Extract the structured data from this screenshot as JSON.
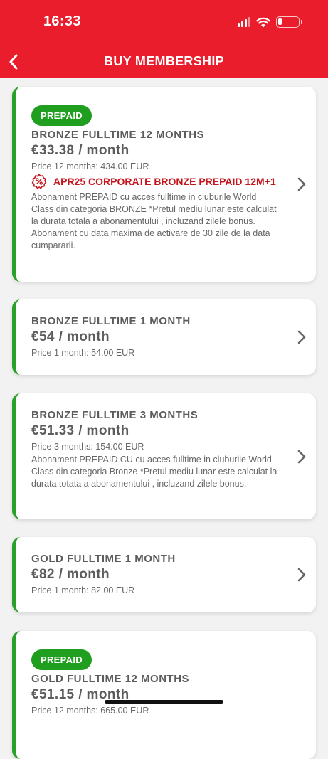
{
  "status_bar": {
    "time": "16:33"
  },
  "header": {
    "title": "BUY MEMBERSHIP",
    "back_icon": "chevron-left-icon"
  },
  "colors": {
    "header_bg": "#ea1d2c",
    "accent_green": "#2aa02a",
    "promo_red": "#c4141c"
  },
  "cards": [
    {
      "badge": "PREPAID",
      "title": "BRONZE FULLTIME 12 MONTHS",
      "price": "€33.38 / month",
      "subtitle": "Price 12 months: 434.00 EUR",
      "promo": "APR25 CORPORATE BRONZE PREPAID 12M+1",
      "description": "Abonament PREPAID cu acces fulltime in cluburile World Class din categoria BRONZE  *Pretul mediu lunar este calculat la durata totala a abonamentului , incluzand zilele bonus. Abonament cu data maxima de activare de 30 zile de la data cumpararii."
    },
    {
      "title": "BRONZE FULLTIME 1 MONTH",
      "price": "€54 / month",
      "subtitle": "Price 1 month: 54.00 EUR"
    },
    {
      "title": "BRONZE FULLTIME 3 MONTHS",
      "price": "€51.33 / month",
      "subtitle": "Price 3 months: 154.00 EUR",
      "description": "Abonament PREPAID CU cu acces fulltime in cluburile World Class din categoria Bronze *Pretul mediu lunar este calculat la durata totata a abonamentului , incluzand zilele bonus."
    },
    {
      "title": "GOLD FULLTIME 1 MONTH",
      "price": "€82 / month",
      "subtitle": "Price 1 month: 82.00 EUR"
    },
    {
      "badge": "PREPAID",
      "title": "GOLD FULLTIME 12 MONTHS",
      "price": "€51.15 / month",
      "subtitle": "Price 12 months: 665.00 EUR"
    }
  ]
}
